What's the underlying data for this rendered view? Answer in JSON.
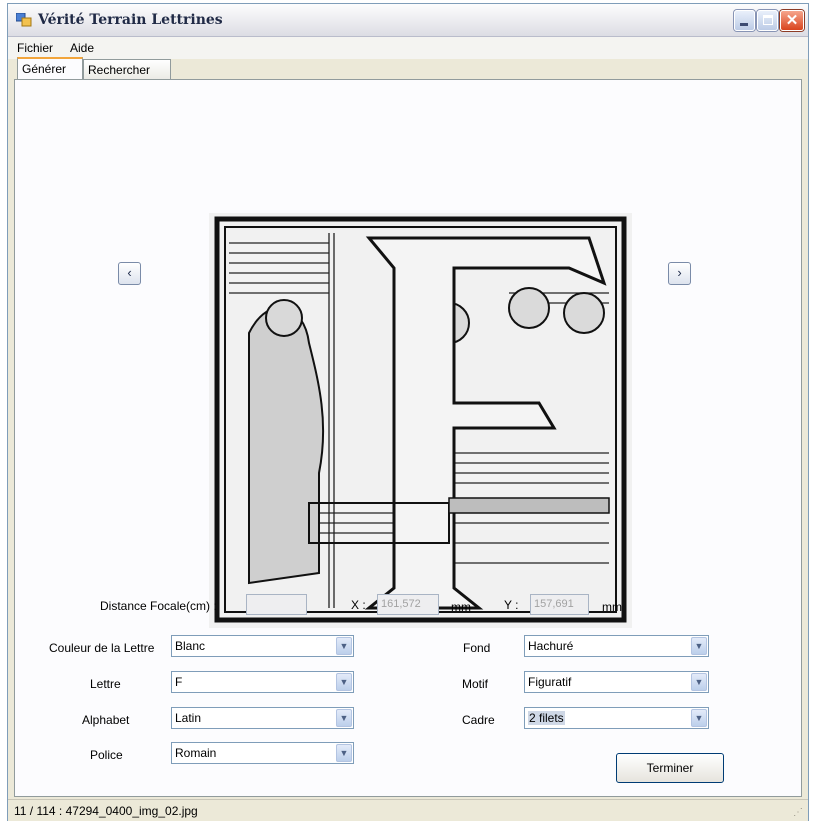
{
  "window": {
    "title": "Vérité Terrain Lettrines",
    "icons": {
      "app": "app-window-icon",
      "minimize": "minimize-icon",
      "maximize": "maximize-icon",
      "close": "close-icon"
    }
  },
  "menu": {
    "items": [
      {
        "label": "Fichier"
      },
      {
        "label": "Aide"
      }
    ]
  },
  "tabs": [
    {
      "label": "Générer",
      "active": true
    },
    {
      "label": "Rechercher",
      "active": false
    }
  ],
  "navigation": {
    "prev_label": "‹",
    "next_label": "›"
  },
  "image": {
    "letter": "F",
    "description_icon": "lettrine-image"
  },
  "measurements": {
    "focal_label": "Distance Focale(cm) :",
    "focal_value": "",
    "x_label": "X :",
    "x_value": "161,572",
    "x_unit": "mm",
    "y_label": "Y :",
    "y_value": "157,691",
    "y_unit": "mm"
  },
  "left_fields": [
    {
      "label": "Couleur de la Lettre",
      "value": "Blanc"
    },
    {
      "label": "Lettre",
      "value": "F"
    },
    {
      "label": "Alphabet",
      "value": "Latin"
    },
    {
      "label": "Police",
      "value": "Romain"
    }
  ],
  "right_fields": [
    {
      "label": "Fond",
      "value": "Hachuré"
    },
    {
      "label": "Motif",
      "value": "Figuratif"
    },
    {
      "label": "Cadre",
      "value": "2 filets"
    }
  ],
  "finish_button": "Terminer",
  "status": "11 / 114 : 47294_0400_img_02.jpg",
  "colors": {
    "accent_tab": "#f2a53b",
    "close_button": "#d9441e",
    "background": "#ece9d8"
  }
}
